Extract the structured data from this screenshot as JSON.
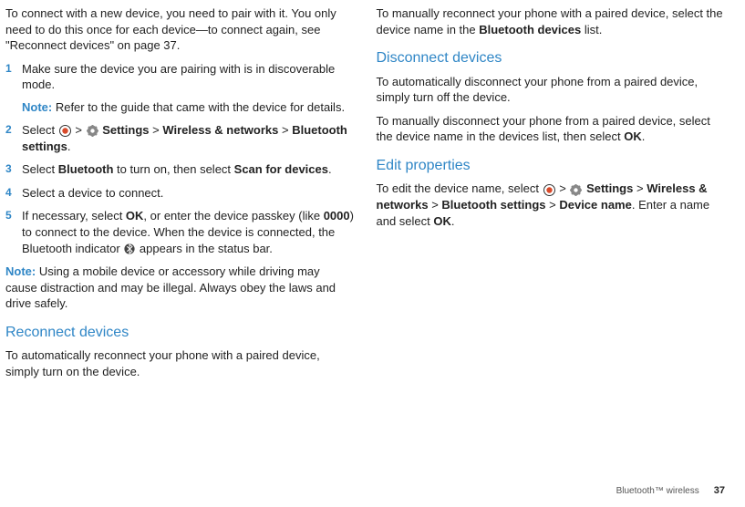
{
  "left": {
    "intro": "To connect with a new device, you need to pair with it. You only need to do this once for each device—to connect again, see \"Reconnect devices\" on page 37.",
    "steps": [
      {
        "n": "1",
        "body": "Make sure the device you are pairing with is in discoverable mode.",
        "sub_note_label": "Note:",
        "sub_note": " Refer to the guide that came with the device for details."
      },
      {
        "n": "2",
        "pre": "Select ",
        "gt1": " > ",
        "settings": "Settings",
        "gt2": " > ",
        "wn": "Wireless & networks",
        "gt3": " > ",
        "bs": "Bluetooth settings",
        "post": "."
      },
      {
        "n": "3",
        "pre": "Select ",
        "bt": "Bluetooth",
        "mid": " to turn on, then select ",
        "scan": "Scan for devices",
        "post": "."
      },
      {
        "n": "4",
        "body": "Select a device to connect."
      },
      {
        "n": "5",
        "pre": "If necessary, select ",
        "ok": "OK",
        "mid1": ", or enter the device passkey (like ",
        "code": "0000",
        "mid2": ") to connect to the device. When the device is connected, the Bluetooth indicator ",
        "post": " appears in the status bar."
      }
    ],
    "bottom_note_label": "Note:",
    "bottom_note": " Using a mobile device or accessory while driving may cause distraction and may be illegal. Always obey the laws and drive safely.",
    "h_reconnect": "Reconnect devices",
    "reconnect_body": "To automatically reconnect your phone with a paired device, simply turn on the device."
  },
  "right": {
    "manual_reconnect_pre": "To manually reconnect your phone with a paired device, select the device name in the ",
    "bd": "Bluetooth devices",
    "manual_reconnect_post": " list.",
    "h_disconnect": "Disconnect devices",
    "disc_auto": "To automatically disconnect your phone from a paired device, simply turn off the device.",
    "disc_manual_pre": "To manually disconnect your phone from a paired device, select the device name in the devices list, then select ",
    "ok": "OK",
    "disc_manual_post": ".",
    "h_edit": "Edit properties",
    "edit_pre": "To edit the device name, select ",
    "gt1": " > ",
    "settings": "Settings",
    "gt2": " > ",
    "wn": "Wireless & networks",
    "gt3": " > ",
    "bs": "Bluetooth settings",
    "gt4": " > ",
    "dn": "Device name",
    "edit_mid": ". Enter a name and select ",
    "ok2": "OK",
    "edit_post": "."
  },
  "footer": {
    "section": "Bluetooth™ wireless",
    "page": "37"
  }
}
